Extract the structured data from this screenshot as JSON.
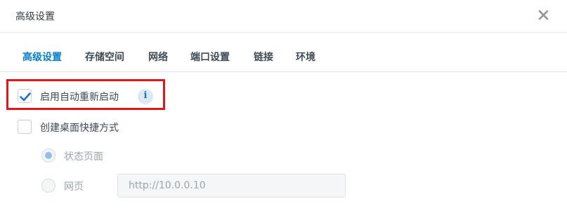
{
  "dialog": {
    "title": "高级设置",
    "close_icon": "close-icon"
  },
  "tabs": [
    {
      "label": "高级设置",
      "active": true
    },
    {
      "label": "存储空间",
      "active": false
    },
    {
      "label": "网络",
      "active": false
    },
    {
      "label": "端口设置",
      "active": false
    },
    {
      "label": "链接",
      "active": false
    },
    {
      "label": "环境",
      "active": false
    }
  ],
  "options": {
    "auto_restart": {
      "label": "启用自动重新启动",
      "checked": true,
      "info_icon": "info-icon",
      "info_glyph": "i"
    },
    "desktop_shortcut": {
      "label": "创建桌面快捷方式",
      "checked": false
    },
    "shortcut_target": {
      "status_page": {
        "label": "状态页面",
        "selected": true,
        "disabled": true
      },
      "web_page": {
        "label": "网页",
        "selected": false,
        "disabled": true
      },
      "url_value": "http://10.0.0.10"
    }
  },
  "colors": {
    "accent": "#0a80c8",
    "highlight_border": "#e0161d",
    "check": "#1a73c9"
  }
}
